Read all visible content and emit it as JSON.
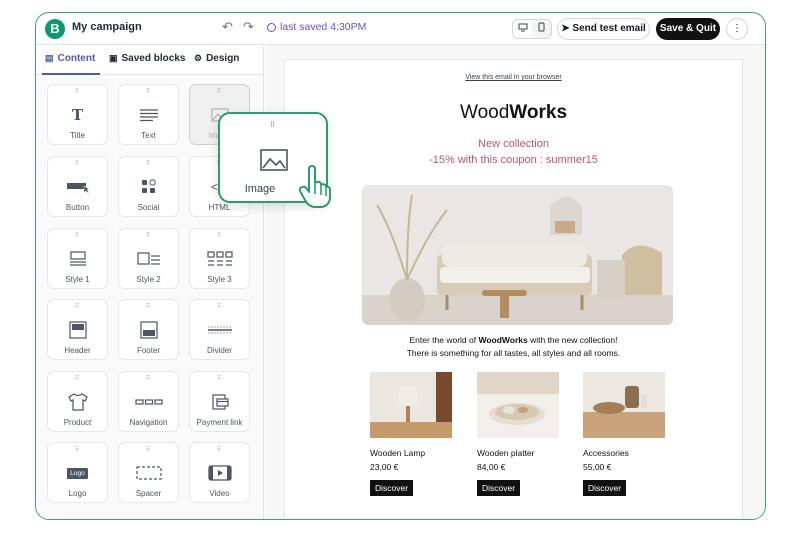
{
  "header": {
    "logo_letter": "B",
    "title": "My campaign",
    "undo_icon": "↶",
    "redo_icon": "↷",
    "last_saved": "last saved 4:30PM",
    "send_test": "Send test email",
    "save_quit": "Save & Quit",
    "more": "⋮"
  },
  "sidebar": {
    "tabs": [
      {
        "label": "Content",
        "icon": "content-icon"
      },
      {
        "label": "Saved blocks",
        "icon": "save-icon"
      },
      {
        "label": "Design",
        "icon": "gear-icon"
      }
    ],
    "tiles": [
      {
        "label": "Title"
      },
      {
        "label": "Text"
      },
      {
        "label": "Image"
      },
      {
        "label": "Button"
      },
      {
        "label": "Social"
      },
      {
        "label": "HTML"
      },
      {
        "label": "Style 1"
      },
      {
        "label": "Style 2"
      },
      {
        "label": "Style 3"
      },
      {
        "label": "Header"
      },
      {
        "label": "Footer"
      },
      {
        "label": "Divider"
      },
      {
        "label": "Product"
      },
      {
        "label": "Navigation"
      },
      {
        "label": "Payment link"
      },
      {
        "label": "Logo"
      },
      {
        "label": "Spacer"
      },
      {
        "label": "Video"
      }
    ],
    "logo_badge": "Logo",
    "dragging": {
      "label": "Image"
    }
  },
  "email": {
    "view_link": "View this email in your browser",
    "brand_a": "Wood",
    "brand_b": "Works",
    "headline": "New collection",
    "coupon": "-15% with this coupon : summer15",
    "intro_a": "Enter the world of ",
    "intro_brand": "WoodWorks",
    "intro_b": " with the new collection!",
    "intro_line2": "There is something for all tastes, all styles and all rooms.",
    "products": [
      {
        "name": "Wooden Lamp",
        "price": "23,00 €",
        "cta": "Discover"
      },
      {
        "name": "Wooden platter",
        "price": "84,00 €",
        "cta": "Discover"
      },
      {
        "name": "Accessories",
        "price": "55,00 €",
        "cta": "Discover"
      }
    ]
  },
  "colors": {
    "brand_green": "#0b996e",
    "frame_green": "#3aa56f",
    "accent_purple": "#6d4fc2",
    "tab_blue": "#4b5fa8",
    "headline_pink": "#b5566f"
  }
}
